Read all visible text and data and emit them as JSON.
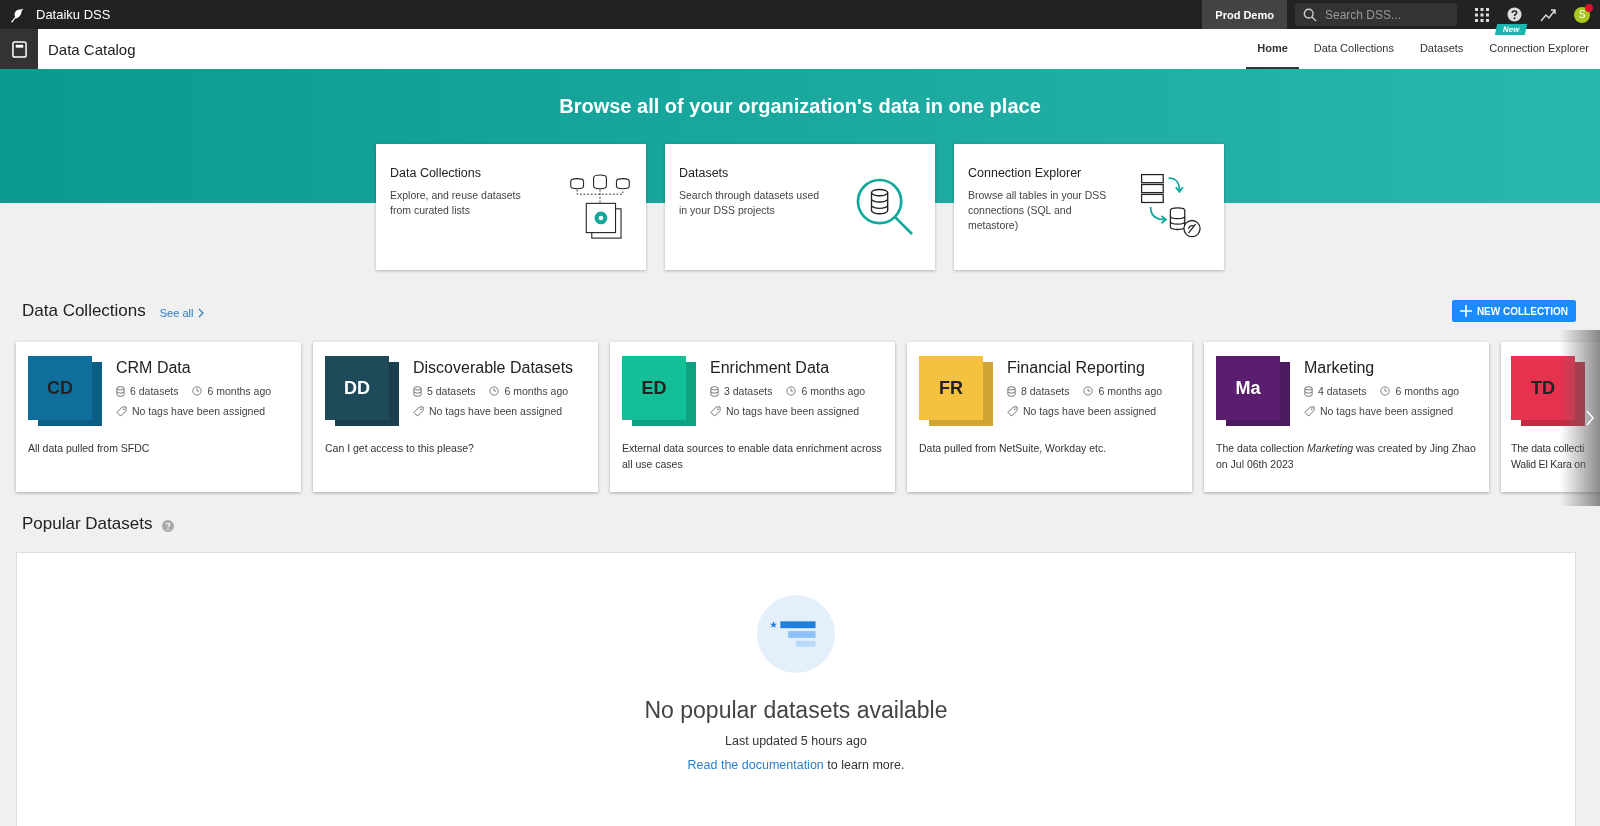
{
  "topbar": {
    "app_name": "Dataiku DSS",
    "project": "Prod Demo",
    "search": {
      "placeholder": "Search DSS..."
    },
    "new_badge": "New",
    "avatar": "S",
    "notification": true
  },
  "header": {
    "title": "Data Catalog",
    "tabs": [
      {
        "label": "Home",
        "selected": true
      },
      {
        "label": "Data Collections",
        "selected": false
      },
      {
        "label": "Datasets",
        "selected": false
      },
      {
        "label": "Connection Explorer",
        "selected": false
      }
    ]
  },
  "hero": {
    "title": "Browse all of your organization's data in one place",
    "cards": [
      {
        "kind": "collections",
        "title": "Data Collections",
        "description": "Explore, and reuse datasets from curated lists"
      },
      {
        "kind": "datasets",
        "title": "Datasets",
        "description": "Search through datasets used in your DSS projects"
      },
      {
        "kind": "connections",
        "title": "Connection Explorer",
        "description": "Browse all tables in your DSS connections (SQL and metastore)"
      }
    ]
  },
  "collections": {
    "title": "Data Collections",
    "see_all": "See all",
    "new_button": "NEW COLLECTION",
    "items": [
      {
        "kind": "full",
        "initials": "CD",
        "color": "#0e6f9c",
        "name": "CRM Data",
        "datasets": "6 datasets",
        "updated": "6 months ago",
        "tags": "No tags have been assigned",
        "description": "All data pulled from SFDC"
      },
      {
        "kind": "full",
        "initials": "DD",
        "color": "#1e4a5a",
        "name": "Discoverable Datasets",
        "datasets": "5 datasets",
        "updated": "6 months ago",
        "tags": "No tags have been assigned",
        "description": "Can I get access to this please?"
      },
      {
        "kind": "full",
        "initials": "ED",
        "color": "#12bf96",
        "name": "Enrichment Data",
        "datasets": "3 datasets",
        "updated": "6 months ago",
        "tags": "No tags have been assigned",
        "description": "External data sources to enable data enrichment across all use cases"
      },
      {
        "kind": "full",
        "initials": "FR",
        "color": "#f5c240",
        "name": "Financial Reporting",
        "datasets": "8 datasets",
        "updated": "6 months ago",
        "tags": "No tags have been assigned",
        "description": "Data pulled from NetSuite, Workday etc."
      },
      {
        "kind": "full",
        "initials": "Ma",
        "color": "#5a1e6e",
        "name": "Marketing",
        "datasets": "4 datasets",
        "updated": "6 months ago",
        "tags": "No tags have been assigned",
        "description": "The data collection *Marketing* was created by Jing Zhao on Jul 06th 2023"
      },
      {
        "kind": "partial",
        "initials": "TD",
        "color": "#e6324f",
        "lines": [
          "The data collecti",
          "Walid El Kara on"
        ]
      }
    ]
  },
  "popular": {
    "title": "Popular Datasets",
    "empty_title": "No popular datasets available",
    "updated": "Last updated 5 hours ago",
    "link": "Read the documentation",
    "link_suffix": "to learn more."
  }
}
